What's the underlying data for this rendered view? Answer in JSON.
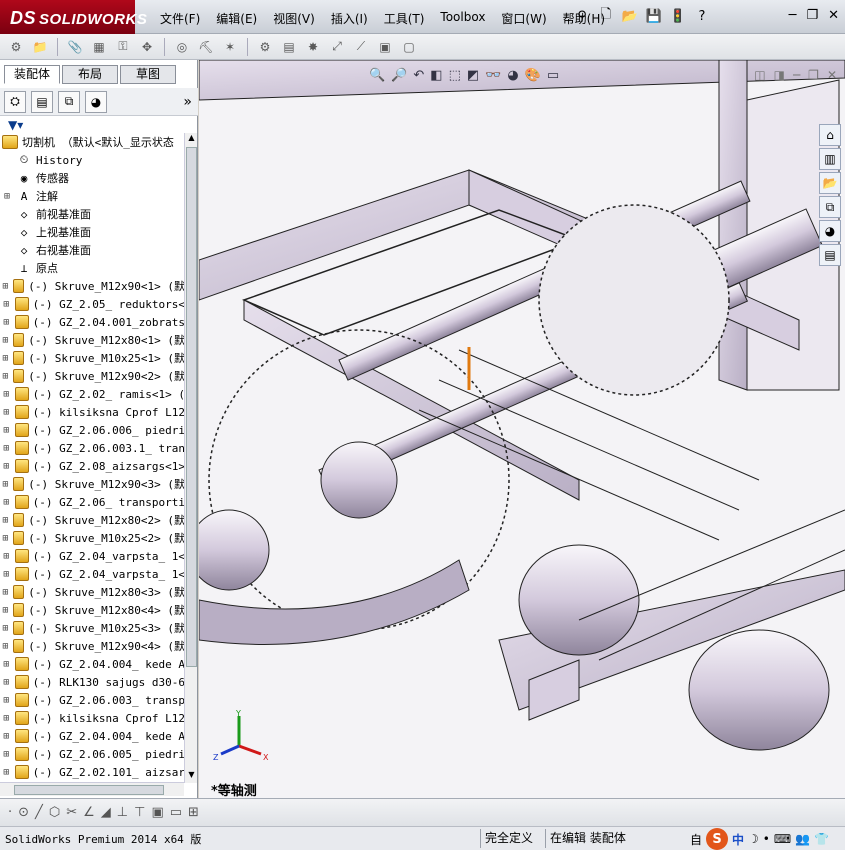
{
  "app": {
    "brand_ds": "DS",
    "brand_name": "SOLIDWORKS"
  },
  "menu": [
    "文件(F)",
    "编辑(E)",
    "视图(V)",
    "插入(I)",
    "工具(T)",
    "Toolbox",
    "窗口(W)",
    "帮助(H)"
  ],
  "tabs": [
    "装配体",
    "布局",
    "草图"
  ],
  "tree": {
    "root": "切割机 （默认<默认_显示状态",
    "fixed": [
      "History",
      "传感器",
      "注解",
      "前视基准面",
      "上视基准面",
      "右视基准面",
      "原点"
    ],
    "components": [
      "(-) Skruve_M12x90<1> (默",
      "(-) GZ_2.05_ reduktors<",
      "(-) GZ_2.04.001_zobrats",
      "(-) Skruve_M12x80<1> (默",
      "(-) Skruve_M10x25<1> (默",
      "(-) Skruve_M12x90<2> (默",
      "(-) GZ_2.02_ ramis<1> (",
      "(-) kilsiksna Cprof L12",
      "(-) GZ_2.06.006_ piedri",
      "(-) GZ_2.06.003.1_ tran",
      "(-) GZ_2.08_aizsargs<1>",
      "(-) Skruve_M12x90<3> (默",
      "(-) GZ_2.06_ transporti",
      "(-) Skruve_M12x80<2> (默",
      "(-) Skruve_M10x25<2> (默",
      "(-) GZ_2.04_varpsta_ 1<",
      "(-) GZ_2.04_varpsta_ 1<",
      "(-) Skruve_M12x80<3> (默",
      "(-) Skruve_M12x80<4> (默",
      "(-) Skruve_M10x25<3> (默",
      "(-) Skruve_M12x90<4> (默",
      "(-) GZ_2.04.004_ kede A",
      "(-) RLK130 sajugs d30-6",
      "(-) GZ_2.06.003_ transp",
      "(-) kilsiksna Cprof L12",
      "(-) GZ_2.04.004_ kede A",
      "(-) GZ_2.06.005_ piedri",
      "(-) GZ_2.02.101_ aizsar"
    ]
  },
  "viewport": {
    "view_name": "*等轴测",
    "triad": {
      "x": "X",
      "y": "Y",
      "z": "Z"
    }
  },
  "status": {
    "product": "SolidWorks Premium 2014 x64 版",
    "defined": "完全定义",
    "mode": "在编辑 装配体",
    "ime_prefix": "自",
    "ime_lang": "中"
  },
  "colors": {
    "brand": "#b0081a",
    "frame": "#d8cfe0",
    "frame_dark": "#9a8fa8",
    "edge": "#222222"
  }
}
